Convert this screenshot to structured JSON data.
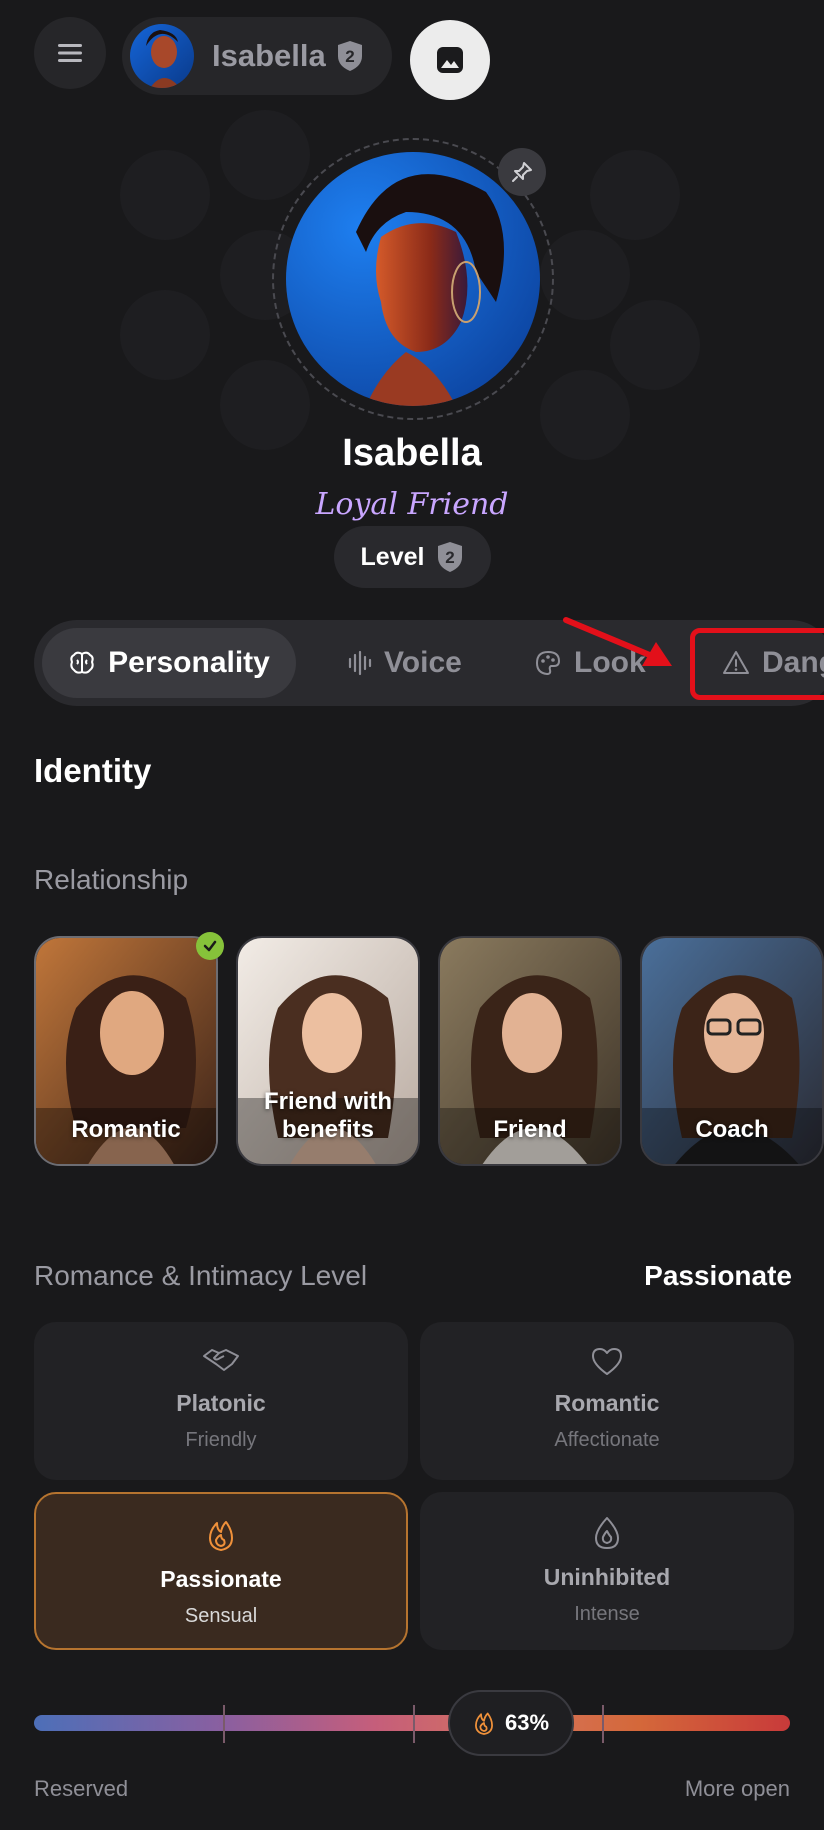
{
  "header": {
    "user_name": "Isabella",
    "level_badge": "2"
  },
  "profile": {
    "name": "Isabella",
    "role": "Loyal Friend",
    "level_label": "Level",
    "level_value": "2"
  },
  "tabs": [
    {
      "label": "Personality",
      "icon": "brain-icon",
      "active": true
    },
    {
      "label": "Voice",
      "icon": "waveform-icon",
      "active": false
    },
    {
      "label": "Look",
      "icon": "palette-icon",
      "active": false
    },
    {
      "label": "Dang",
      "icon": "warning-icon",
      "active": false
    }
  ],
  "identity": {
    "title": "Identity",
    "relationship_title": "Relationship",
    "relationship_options": [
      {
        "label": "Romantic",
        "selected": true
      },
      {
        "label": "Friend with benefits",
        "selected": false
      },
      {
        "label": "Friend",
        "selected": false
      },
      {
        "label": "Coach",
        "selected": false
      }
    ]
  },
  "romance": {
    "title": "Romance & Intimacy Level",
    "current": "Passionate",
    "options": [
      {
        "title": "Platonic",
        "subtitle": "Friendly",
        "icon": "handshake-icon",
        "selected": false
      },
      {
        "title": "Romantic",
        "subtitle": "Affectionate",
        "icon": "heart-icon",
        "selected": false
      },
      {
        "title": "Passionate",
        "subtitle": "Sensual",
        "icon": "flame-icon",
        "selected": true
      },
      {
        "title": "Uninhibited",
        "subtitle": "Intense",
        "icon": "drop-flame-icon",
        "selected": false
      }
    ],
    "slider": {
      "value_label": "63%",
      "value": 0.63,
      "min_label": "Reserved",
      "max_label": "More open"
    }
  },
  "colors": {
    "background": "#19191b",
    "accent_purple": "#c9a6ff",
    "selected_orange": "#b6742f",
    "highlight_red": "#e3101a",
    "check_green": "#86c23a"
  }
}
